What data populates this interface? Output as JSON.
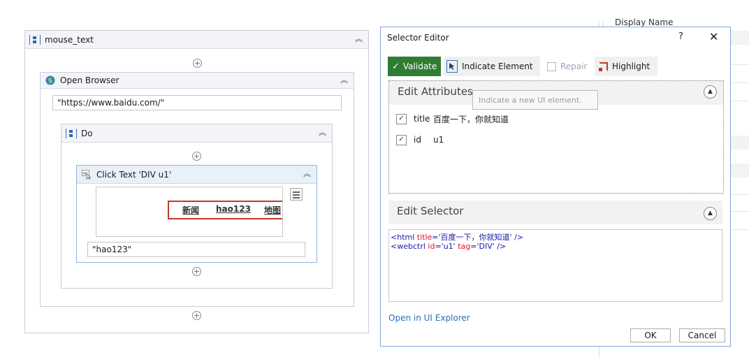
{
  "properties_panel": {
    "display_name_label": "Display Name"
  },
  "designer": {
    "root": {
      "title": "mouse_text"
    },
    "open_browser": {
      "title": "Open Browser",
      "url": "\"https://www.baidu.com/\""
    },
    "do": {
      "title": "Do"
    },
    "click_text": {
      "title": "Click Text 'DIV  u1'",
      "preview_links": [
        "新闻",
        "hao123",
        "地图"
      ],
      "text_value": "\"hao123\""
    }
  },
  "selector_editor": {
    "title": "Selector Editor",
    "help": "?",
    "close": "✕",
    "toolbar": {
      "validate": "Validate",
      "indicate_element": "Indicate Element",
      "repair": "Repair",
      "highlight": "Highlight"
    },
    "edit_attributes": {
      "title": "Edit Attributes",
      "tooltip": "Indicate a new UI element.",
      "attributes": [
        {
          "name": "title",
          "value": "百度一下，你就知道",
          "checked": true
        },
        {
          "name": "id",
          "value": "u1",
          "checked": true
        }
      ]
    },
    "edit_selector": {
      "title": "Edit Selector",
      "lines": [
        {
          "open": "<html ",
          "attrs": [
            {
              "name": "title",
              "value": "'百度一下，你就知道'"
            }
          ],
          "close": " />"
        },
        {
          "open": "<webctrl ",
          "attrs": [
            {
              "name": "id",
              "value": "'u1'"
            },
            {
              "name": "tag",
              "value": "'DIV'"
            }
          ],
          "close": " />"
        }
      ]
    },
    "open_in_ui_explorer": "Open in UI Explorer",
    "ok": "OK",
    "cancel": "Cancel"
  },
  "colors": {
    "validate_green": "#2f7d32",
    "link_blue": "#2f6db5",
    "dialog_border": "#7fa7d8",
    "highlight_red": "#c0392b"
  }
}
